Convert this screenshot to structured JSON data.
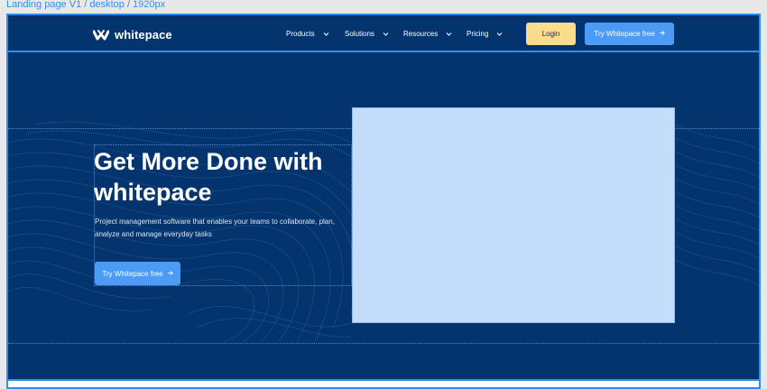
{
  "frame_label": "Landing page V1 / desktop / 1920px",
  "brand": {
    "name": "whitepace",
    "logo_icon": "whitepace-logo-icon"
  },
  "nav": {
    "items": [
      {
        "label": "Products",
        "icon": "chevron-down-icon"
      },
      {
        "label": "Solutions",
        "icon": "chevron-down-icon"
      },
      {
        "label": "Resources",
        "icon": "chevron-down-icon"
      },
      {
        "label": "Pricing",
        "icon": "chevron-down-icon"
      }
    ],
    "login_label": "Login",
    "try_label": "Try Whitepace free",
    "try_icon": "arrow-right-icon"
  },
  "hero": {
    "headline": "Get More Done with whitepace",
    "subtext": "Project management software that enables your teams to collaborate, plan, analyze and manage everyday tasks",
    "cta_label": "Try Whitepace free",
    "cta_icon": "arrow-right-icon"
  },
  "colors": {
    "background": "#04346d",
    "accent": "#4c9bf7",
    "login": "#fbdc8e",
    "selection": "#2f8fef",
    "image_placeholder": "#c3ddfb"
  }
}
